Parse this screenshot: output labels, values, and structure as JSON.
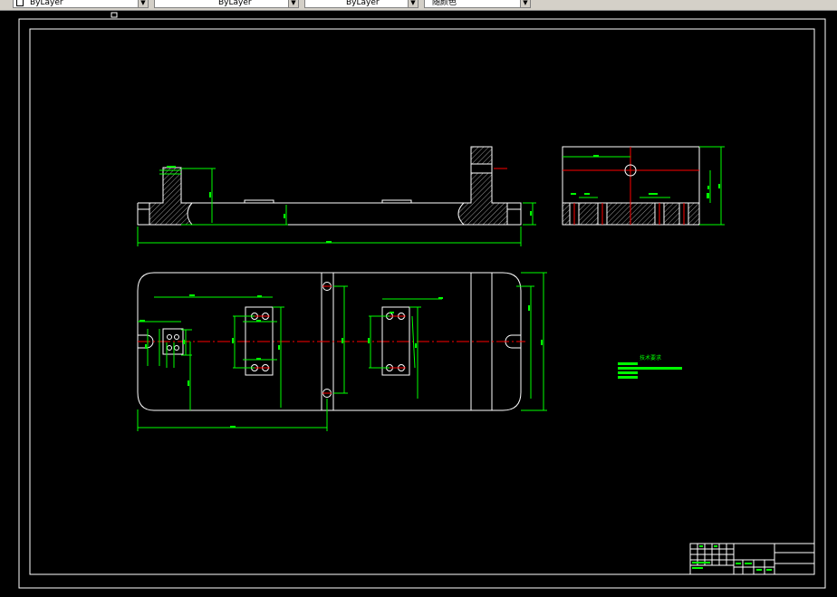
{
  "toolbar": {
    "color_combo": "ByLayer",
    "linetype_combo": "ByLayer",
    "lineweight_combo": "ByLayer",
    "plotstyle_combo": "随颜色"
  },
  "colors": {
    "background": "#000000",
    "outline": "#ffffff",
    "dimension": "#00ff00",
    "centerline": "#ff0000",
    "hatch": "#808080",
    "toolbar": "#d4d0c8"
  },
  "notes": {
    "title": "技术要求"
  }
}
